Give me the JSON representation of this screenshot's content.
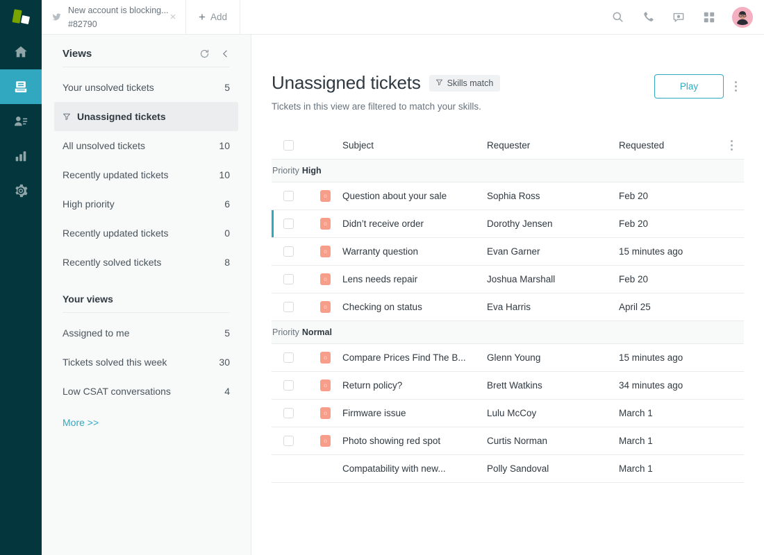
{
  "brand": {
    "rail_bg": "#03363d",
    "accent": "#31a8bf",
    "logo_green": "#78a300"
  },
  "tab": {
    "icon": "twitter-bird-icon",
    "title": "New account is blocking...",
    "subtitle": "#82790",
    "close_label": "×"
  },
  "add_tab": {
    "plus": "+",
    "label": "Add"
  },
  "topbar_icons": [
    {
      "name": "search-icon"
    },
    {
      "name": "phone-icon"
    },
    {
      "name": "chat-icon"
    },
    {
      "name": "apps-grid-icon"
    }
  ],
  "rail": {
    "items": [
      {
        "name": "home-icon",
        "label": "Home",
        "active": false
      },
      {
        "name": "views-icon",
        "label": "Views",
        "active": true
      },
      {
        "name": "customers-icon",
        "label": "Customers",
        "active": false
      },
      {
        "name": "reporting-icon",
        "label": "Reporting",
        "active": false
      },
      {
        "name": "admin-gear-icon",
        "label": "Admin",
        "active": false
      }
    ]
  },
  "views_panel": {
    "title": "Views",
    "refresh_icon": "refresh-icon",
    "collapse_icon": "chevron-left-icon",
    "items": [
      {
        "label": "Your unsolved tickets",
        "count": "5",
        "selected": false,
        "filtered": false
      },
      {
        "label": "Unassigned tickets",
        "count": "",
        "selected": true,
        "filtered": true
      },
      {
        "label": "All unsolved tickets",
        "count": "10",
        "selected": false,
        "filtered": false
      },
      {
        "label": "Recently updated tickets",
        "count": "10",
        "selected": false,
        "filtered": false
      },
      {
        "label": "High priority",
        "count": "6",
        "selected": false,
        "filtered": false
      },
      {
        "label": "Recently updated tickets",
        "count": "0",
        "selected": false,
        "filtered": false
      },
      {
        "label": "Recently solved tickets",
        "count": "8",
        "selected": false,
        "filtered": false
      }
    ],
    "your_views_title": "Your views",
    "your_views": [
      {
        "label": "Assigned to me",
        "count": "5"
      },
      {
        "label": "Tickets solved this week",
        "count": "30"
      },
      {
        "label": "Low CSAT conversations",
        "count": "4"
      }
    ],
    "more_label": "More >>"
  },
  "main": {
    "title": "Unassigned tickets",
    "skills_badge": {
      "icon": "funnel-icon",
      "label": "Skills match"
    },
    "subtitle": "Tickets in this view are filtered to match your skills.",
    "play_label": "Play",
    "options_icon": "kebab-menu-icon"
  },
  "table": {
    "columns": [
      "Subject",
      "Requester",
      "Requested"
    ],
    "header_options_icon": "kebab-menu-icon",
    "groups": [
      {
        "group_prefix": "Priority",
        "group_value": "High",
        "rows": [
          {
            "subject": "Question about your sale",
            "requester": "Sophia Ross",
            "requested": "Feb 20",
            "has_checkbox": true,
            "has_priority": true,
            "marked": false
          },
          {
            "subject": "Didn’t receive order",
            "requester": "Dorothy Jensen",
            "requested": "Feb 20",
            "has_checkbox": true,
            "has_priority": true,
            "marked": true
          },
          {
            "subject": "Warranty question",
            "requester": "Evan Garner",
            "requested": "15 minutes ago",
            "has_checkbox": true,
            "has_priority": true,
            "marked": false
          },
          {
            "subject": "Lens needs repair",
            "requester": "Joshua Marshall",
            "requested": "Feb 20",
            "has_checkbox": true,
            "has_priority": true,
            "marked": false
          },
          {
            "subject": "Checking on status",
            "requester": "Eva Harris",
            "requested": "April 25",
            "has_checkbox": true,
            "has_priority": true,
            "marked": false
          }
        ]
      },
      {
        "group_prefix": "Priority",
        "group_value": "Normal",
        "rows": [
          {
            "subject": "Compare Prices Find The B...",
            "requester": "Glenn Young",
            "requested": "15 minutes ago",
            "has_checkbox": true,
            "has_priority": true,
            "marked": false
          },
          {
            "subject": "Return policy?",
            "requester": "Brett Watkins",
            "requested": "34 minutes ago",
            "has_checkbox": true,
            "has_priority": true,
            "marked": false
          },
          {
            "subject": "Firmware issue",
            "requester": "Lulu McCoy",
            "requested": "March 1",
            "has_checkbox": true,
            "has_priority": true,
            "marked": false
          },
          {
            "subject": "Photo showing red spot",
            "requester": "Curtis Norman",
            "requested": "March 1",
            "has_checkbox": true,
            "has_priority": true,
            "marked": false
          },
          {
            "subject": "Compatability with new...",
            "requester": "Polly Sandoval",
            "requested": "March 1",
            "has_checkbox": false,
            "has_priority": false,
            "marked": false
          }
        ]
      }
    ]
  }
}
